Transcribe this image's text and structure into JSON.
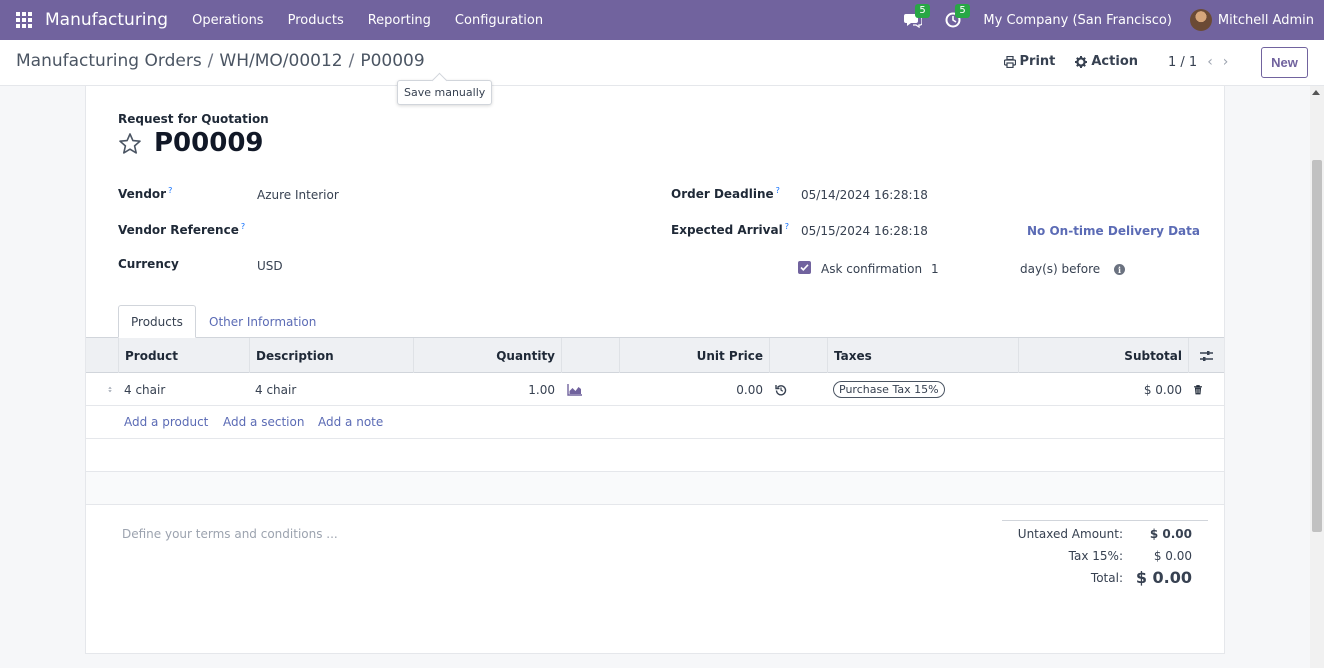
{
  "navbar": {
    "app_name": "Manufacturing",
    "menu": [
      "Operations",
      "Products",
      "Reporting",
      "Configuration"
    ],
    "messages_badge": "5",
    "activities_badge": "5",
    "company": "My Company (San Francisco)",
    "user": "Mitchell Admin"
  },
  "breadcrumb": {
    "items": [
      "Manufacturing Orders",
      "WH/MO/00012",
      "P00009"
    ],
    "separator": "/"
  },
  "tooltip": "Save manually",
  "control": {
    "print": "Print",
    "action": "Action",
    "pager": "1 / 1",
    "new": "New"
  },
  "form": {
    "doc_type": "Request for Quotation",
    "name": "P00009",
    "vendor_label": "Vendor",
    "vendor_value": "Azure Interior",
    "vendor_ref_label": "Vendor Reference",
    "vendor_ref_value": "",
    "currency_label": "Currency",
    "currency_value": "USD",
    "order_deadline_label": "Order Deadline",
    "order_deadline_value": "05/14/2024 16:28:18",
    "expected_arrival_label": "Expected Arrival",
    "expected_arrival_value": "05/15/2024 16:28:18",
    "on_time": "No On-time Delivery Data",
    "ask_confirmation_label": "Ask confirmation",
    "ask_confirmation_days": "1",
    "days_before": "day(s) before",
    "help_mark": "?"
  },
  "tabs": [
    "Products",
    "Other Information"
  ],
  "table": {
    "headers": {
      "product": "Product",
      "description": "Description",
      "quantity": "Quantity",
      "unit_price": "Unit Price",
      "taxes": "Taxes",
      "subtotal": "Subtotal"
    },
    "rows": [
      {
        "product": "4 chair",
        "description": "4 chair",
        "quantity": "1.00",
        "unit_price": "0.00",
        "tax": "Purchase Tax 15%",
        "subtotal": "$ 0.00"
      }
    ],
    "add_links": [
      "Add a product",
      "Add a section",
      "Add a note"
    ]
  },
  "terms_placeholder": "Define your terms and conditions ...",
  "totals": {
    "untaxed_label": "Untaxed Amount:",
    "untaxed_value": "$ 0.00",
    "tax_label": "Tax 15%:",
    "tax_value": "$ 0.00",
    "total_label": "Total:",
    "total_value": "$ 0.00"
  },
  "colors": {
    "brand": "#71639e",
    "link": "#5b6bb5",
    "badge": "#28a745"
  }
}
